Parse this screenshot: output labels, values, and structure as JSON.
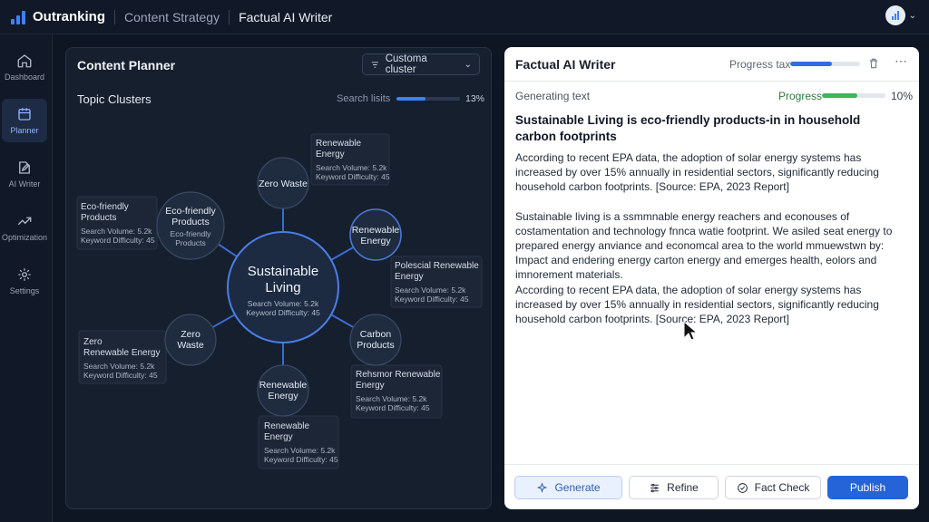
{
  "app": {
    "brand": "Outranking",
    "breadcrumb": [
      "Content Strategy",
      "Factual AI Writer"
    ]
  },
  "sidebar": {
    "items": [
      {
        "label": "Dashboard",
        "icon": "home-icon",
        "active": false
      },
      {
        "label": "Planner",
        "icon": "calendar-icon",
        "active": true
      },
      {
        "label": "AI Writer",
        "icon": "edit-icon",
        "active": false
      },
      {
        "label": "Optimization",
        "icon": "trend-up-icon",
        "active": false
      },
      {
        "label": "Settings",
        "icon": "gear-icon",
        "active": false
      }
    ]
  },
  "planner": {
    "title": "Content Planner",
    "cluster_select": "Customa cluster",
    "clusters_title": "Topic Clusters",
    "search_limits_label": "Search lisits",
    "search_limits_pct": "13%",
    "search_limits_value": 0.45,
    "center": {
      "title_line1": "Sustainable",
      "title_line2": "Living",
      "volume": "Search Volume: 5.2k",
      "difficulty": "Keyword Difficulty: 45"
    },
    "nodes": [
      {
        "lines": [
          "Zero Waste"
        ]
      },
      {
        "lines": [
          "Eco-friendly",
          "Products"
        ],
        "sub": [
          "Eco-friendly",
          "Products"
        ]
      },
      {
        "lines": [
          "Renewable",
          "Energy"
        ]
      },
      {
        "lines": [
          "Zero",
          "Waste"
        ]
      },
      {
        "lines": [
          "Carbon",
          "Products"
        ]
      },
      {
        "lines": [
          "Renewable",
          "Energy"
        ]
      }
    ],
    "info_boxes": [
      {
        "title": [
          "Renewable",
          "Energy"
        ],
        "volume": "Search Volume: 5.2k",
        "difficulty": "Keyword Difficulty: 45"
      },
      {
        "title": [
          "Eco-friendly",
          "Products"
        ],
        "volume": "Search Volume: 5.2k",
        "difficulty": "Keyword Difficulty: 45"
      },
      {
        "title": [
          "Polescial Renewable",
          "Energy"
        ],
        "volume": "Search Volume: 5.2k",
        "difficulty": "Keyword Difficulty: 45"
      },
      {
        "title": [
          "Zero",
          "Renewable Energy"
        ],
        "volume": "Search Volume: 5.2k",
        "difficulty": "Keyword Difficulty: 45"
      },
      {
        "title": [
          "Rehsmor Renewable",
          "Energy"
        ],
        "volume": "Search Volume: 5.2k",
        "difficulty": "Keyword Difficulty: 45"
      },
      {
        "title": [
          "Renewable",
          "Energy"
        ],
        "volume": "Search Volume: 5.2k",
        "difficulty": "Keyword Difficulty: 45"
      }
    ]
  },
  "writer": {
    "title": "Factual AI Writer",
    "progress_tax_label": "Progress tax",
    "progress_tax_value": 0.6,
    "generating_label": "Generating text",
    "progress_label": "Progress",
    "progress_pct": "10%",
    "progress_value": 0.55,
    "doc_title": "Sustainable Living is eco-friendly products-in in household carbon footprints",
    "paragraphs": [
      "According to recent EPA data, the adoption of solar energy systems has increased by over 15% annually in residential sectors, significantly reducing household carbon footprints. [Source: EPA, 2023 Report]",
      "Sustainable living is a ssmmnable energy reachers and econouses of costamentation and technology fnnca watie footprint. We asiled seat energy to prepared energy anviance and economcal area to the world mmuewstwn by: Impact and endering energy carton energy and emerges health, eolors and imnorement materials.",
      "According to recent EPA data, the adoption of solar energy systems has increased by over 15% annually in residential sectors, significantly reducing household carbon footprints. [Source: EPA, 2023 Report]"
    ],
    "buttons": {
      "generate": "Generate",
      "refine": "Refine",
      "fact_check": "Fact Check",
      "publish": "Publish"
    }
  },
  "colors": {
    "accent": "#2563d9",
    "progress_green": "#3fb55a",
    "background": "#0f1623"
  }
}
